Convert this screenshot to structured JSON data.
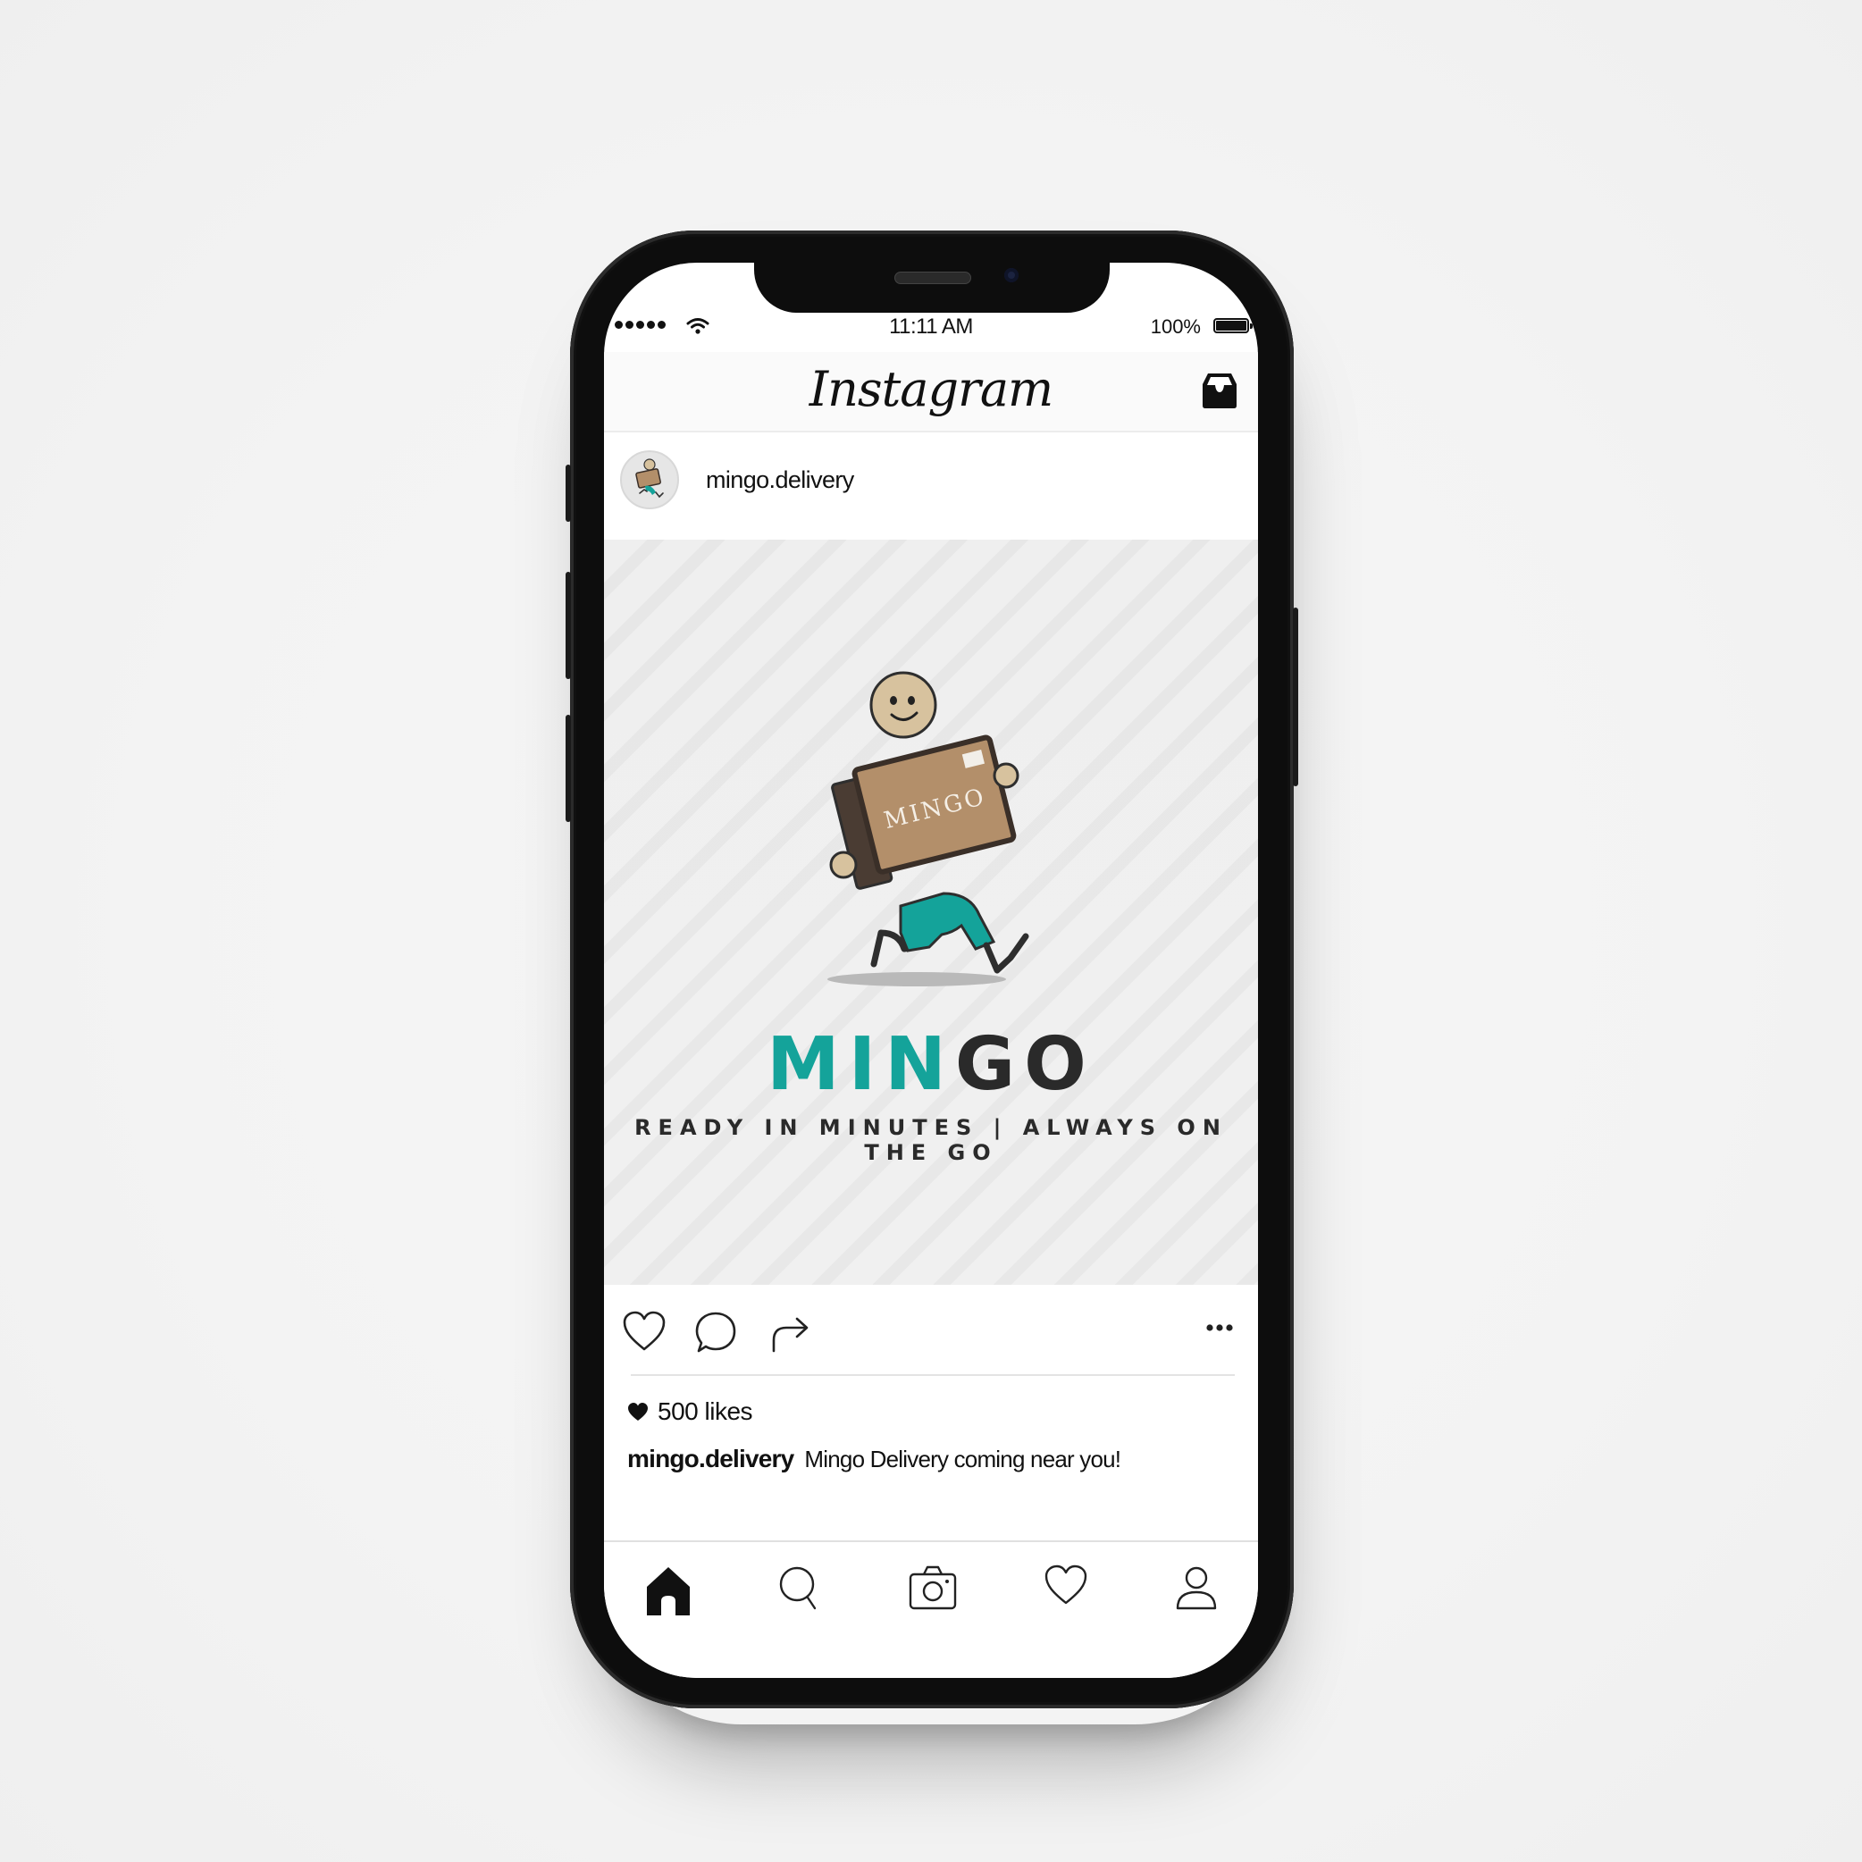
{
  "status_bar": {
    "time": "11:11 AM",
    "battery": "100%",
    "signal_icon": "signal-dots-icon",
    "wifi_icon": "wifi-icon"
  },
  "header": {
    "logo": "Instagram",
    "inbox_icon": "inbox-tray-icon"
  },
  "post": {
    "username": "mingo.delivery",
    "image": {
      "box_label": "MINGO",
      "brand_part1": "MIN",
      "brand_part2": "GO",
      "tagline": "READY IN MINUTES | ALWAYS ON THE GO"
    },
    "actions": {
      "like_icon": "heart-outline-icon",
      "comment_icon": "comment-bubble-icon",
      "share_icon": "share-arrow-icon",
      "more_icon": "more-dots-icon"
    },
    "likes": "500 likes",
    "caption_user": "mingo.delivery",
    "caption_text": "Mingo Delivery coming near you!"
  },
  "tab_bar": [
    "home-icon",
    "search-icon",
    "camera-icon",
    "activity-heart-icon",
    "profile-icon"
  ],
  "colors": {
    "brand_teal": "#14a39a",
    "box_brown": "#b38f6a",
    "skin": "#d7c29e"
  }
}
